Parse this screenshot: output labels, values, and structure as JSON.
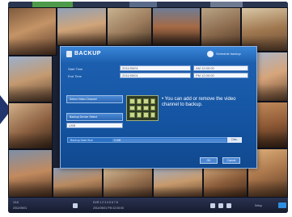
{
  "dialog": {
    "title": "BACKUP",
    "header_hint": "Schedule backup",
    "start_time_label": "Start Time",
    "end_time_label": "End Time",
    "start_date": "2011/05/01",
    "end_date": "2011/05/01",
    "start_time": "AM 12:00:00",
    "end_time": "PM 12:00:00",
    "select_video_label": "Select Video Channel",
    "backup_device_label": "Backup Device Select",
    "device_value": "USB",
    "note": "• You can add or remove the video channel to backup.",
    "backup_size_label": "Backup Data Size",
    "backup_size_value": "0 MB",
    "calc_button": "Calc.",
    "ok_label": "OK",
    "cancel_label": "Cancel"
  },
  "bottombar": {
    "left_text_1": "1/16",
    "left_text_2": "2011/05/01",
    "center_text_1": "DVR 1  2  3  4  5  6  7  8",
    "center_text_2": "2011/05/01 PM 12:00:00",
    "right_text": "Setup"
  },
  "colors": {
    "dialog_bg": "#1454a2",
    "dialog_border": "#8fb4e6",
    "arrow": "#22356c",
    "accent": "#2f8ee0"
  }
}
